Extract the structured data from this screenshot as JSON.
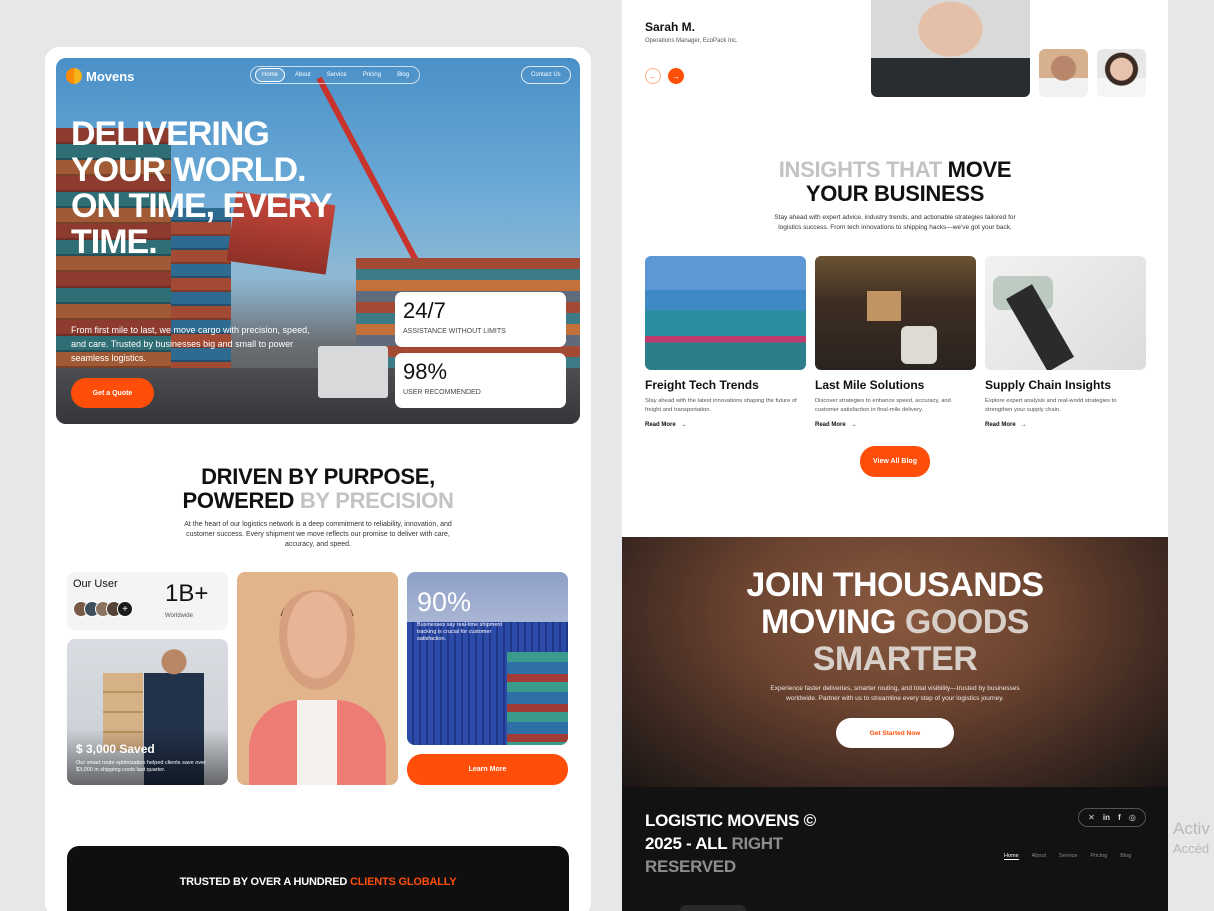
{
  "left": {
    "brand": "Movens",
    "nav": [
      "Home",
      "About",
      "Service",
      "Pricing",
      "Blog"
    ],
    "contact": "Contact Us",
    "hero_title": "DELIVERING YOUR WORLD. ON TIME, EVERY TIME.",
    "hero_text": "From first mile to last, we move cargo with precision, speed, and care. Trusted by businesses big and small to power seamless logistics.",
    "quote_button": "Get a Quote",
    "stats": [
      {
        "value": "24/7",
        "label": "ASSISTANCE WITHOUT LIMITS"
      },
      {
        "value": "98%",
        "label": "USER RECOMMENDED"
      }
    ],
    "section_title_a": "DRIVEN BY PURPOSE,",
    "section_title_b1": "POWERED ",
    "section_title_b2": "BY PRECISION",
    "section_text": "At the heart of our logistics network is a deep commitment to reliability, innovation, and customer success. Every shipment we move reflects our promise to deliver with care, accuracy, and speed.",
    "user_label": "Our User",
    "user_count": "1B+",
    "user_sub": "Worldwide",
    "saved_title": "$ 3,000 Saved",
    "saved_text": "Our smart route optimization helped clients save over $3,000 in shipping costs last quarter.",
    "ninety_value": "90%",
    "ninety_text": "Businesses say real-time shipment tracking is crucial for customer satisfaction.",
    "learn_more": "Learn More",
    "trusted_a": "TRUSTED BY OVER A HUNDRED ",
    "trusted_b": "CLIENTS GLOBALLY"
  },
  "right": {
    "testimonial_name": "Sarah M.",
    "testimonial_role": "Operations Manager, EcoPack Inc.",
    "insights_a": "INSIGHTS THAT ",
    "insights_b": "MOVE",
    "insights_c": "YOUR BUSINESS",
    "insights_text": "Stay ahead with expert advice, industry trends, and actionable strategies tailored for logistics success. From tech innovations to shipping hacks—we've got your back.",
    "blogs": [
      {
        "title": "Freight Tech Trends",
        "desc": "Stay ahead with the latest innovations shaping the future of freight and transportation.",
        "more": "Read More"
      },
      {
        "title": "Last Mile Solutions",
        "desc": "Discover strategies to enhance speed, accuracy, and customer satisfaction in final-mile delivery.",
        "more": "Read More"
      },
      {
        "title": "Supply Chain Insights",
        "desc": "Explore expert analysis and real-world strategies to strengthen your supply chain.",
        "more": "Read More"
      }
    ],
    "view_all": "View All Blog",
    "cta_line1": "JOIN THOUSANDS",
    "cta_line2a": "MOVING ",
    "cta_line2b": "GOODS",
    "cta_line3": "SMARTER",
    "cta_text": "Experience faster deliveries, smarter routing, and total visibility—trusted by businesses worldwide. Partner with us to streamline every step of your logistics journey.",
    "cta_button": "Get Started Now",
    "footer_a": "LOGISTIC MOVENS © 2025 - ALL ",
    "footer_b": "RIGHT RESERVED",
    "footer_nav": [
      "Home",
      "About",
      "Service",
      "Pricing",
      "Blog"
    ],
    "social_icons": [
      "x-icon",
      "linkedin-icon",
      "facebook-icon",
      "instagram-icon"
    ]
  },
  "watermark": {
    "line1": "Activ",
    "line2": "Accéd"
  },
  "colors": {
    "accent": "#ff4d0a",
    "dark": "#121212",
    "canvas": "#e6e7e8"
  }
}
